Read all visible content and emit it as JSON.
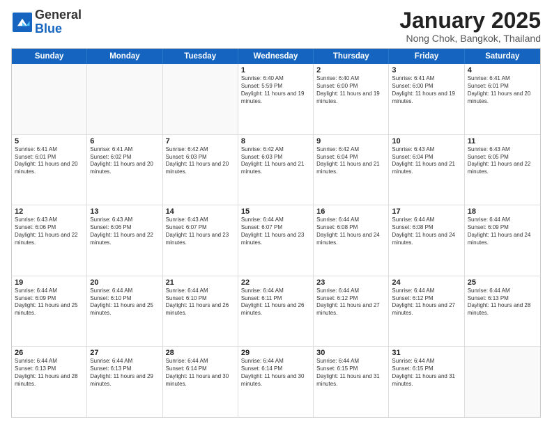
{
  "logo": {
    "general": "General",
    "blue": "Blue"
  },
  "header": {
    "month": "January 2025",
    "location": "Nong Chok, Bangkok, Thailand"
  },
  "weekdays": [
    "Sunday",
    "Monday",
    "Tuesday",
    "Wednesday",
    "Thursday",
    "Friday",
    "Saturday"
  ],
  "weeks": [
    [
      {
        "day": "",
        "info": ""
      },
      {
        "day": "",
        "info": ""
      },
      {
        "day": "",
        "info": ""
      },
      {
        "day": "1",
        "info": "Sunrise: 6:40 AM\nSunset: 5:59 PM\nDaylight: 11 hours and 19 minutes."
      },
      {
        "day": "2",
        "info": "Sunrise: 6:40 AM\nSunset: 6:00 PM\nDaylight: 11 hours and 19 minutes."
      },
      {
        "day": "3",
        "info": "Sunrise: 6:41 AM\nSunset: 6:00 PM\nDaylight: 11 hours and 19 minutes."
      },
      {
        "day": "4",
        "info": "Sunrise: 6:41 AM\nSunset: 6:01 PM\nDaylight: 11 hours and 20 minutes."
      }
    ],
    [
      {
        "day": "5",
        "info": "Sunrise: 6:41 AM\nSunset: 6:01 PM\nDaylight: 11 hours and 20 minutes."
      },
      {
        "day": "6",
        "info": "Sunrise: 6:41 AM\nSunset: 6:02 PM\nDaylight: 11 hours and 20 minutes."
      },
      {
        "day": "7",
        "info": "Sunrise: 6:42 AM\nSunset: 6:03 PM\nDaylight: 11 hours and 20 minutes."
      },
      {
        "day": "8",
        "info": "Sunrise: 6:42 AM\nSunset: 6:03 PM\nDaylight: 11 hours and 21 minutes."
      },
      {
        "day": "9",
        "info": "Sunrise: 6:42 AM\nSunset: 6:04 PM\nDaylight: 11 hours and 21 minutes."
      },
      {
        "day": "10",
        "info": "Sunrise: 6:43 AM\nSunset: 6:04 PM\nDaylight: 11 hours and 21 minutes."
      },
      {
        "day": "11",
        "info": "Sunrise: 6:43 AM\nSunset: 6:05 PM\nDaylight: 11 hours and 22 minutes."
      }
    ],
    [
      {
        "day": "12",
        "info": "Sunrise: 6:43 AM\nSunset: 6:06 PM\nDaylight: 11 hours and 22 minutes."
      },
      {
        "day": "13",
        "info": "Sunrise: 6:43 AM\nSunset: 6:06 PM\nDaylight: 11 hours and 22 minutes."
      },
      {
        "day": "14",
        "info": "Sunrise: 6:43 AM\nSunset: 6:07 PM\nDaylight: 11 hours and 23 minutes."
      },
      {
        "day": "15",
        "info": "Sunrise: 6:44 AM\nSunset: 6:07 PM\nDaylight: 11 hours and 23 minutes."
      },
      {
        "day": "16",
        "info": "Sunrise: 6:44 AM\nSunset: 6:08 PM\nDaylight: 11 hours and 24 minutes."
      },
      {
        "day": "17",
        "info": "Sunrise: 6:44 AM\nSunset: 6:08 PM\nDaylight: 11 hours and 24 minutes."
      },
      {
        "day": "18",
        "info": "Sunrise: 6:44 AM\nSunset: 6:09 PM\nDaylight: 11 hours and 24 minutes."
      }
    ],
    [
      {
        "day": "19",
        "info": "Sunrise: 6:44 AM\nSunset: 6:09 PM\nDaylight: 11 hours and 25 minutes."
      },
      {
        "day": "20",
        "info": "Sunrise: 6:44 AM\nSunset: 6:10 PM\nDaylight: 11 hours and 25 minutes."
      },
      {
        "day": "21",
        "info": "Sunrise: 6:44 AM\nSunset: 6:10 PM\nDaylight: 11 hours and 26 minutes."
      },
      {
        "day": "22",
        "info": "Sunrise: 6:44 AM\nSunset: 6:11 PM\nDaylight: 11 hours and 26 minutes."
      },
      {
        "day": "23",
        "info": "Sunrise: 6:44 AM\nSunset: 6:12 PM\nDaylight: 11 hours and 27 minutes."
      },
      {
        "day": "24",
        "info": "Sunrise: 6:44 AM\nSunset: 6:12 PM\nDaylight: 11 hours and 27 minutes."
      },
      {
        "day": "25",
        "info": "Sunrise: 6:44 AM\nSunset: 6:13 PM\nDaylight: 11 hours and 28 minutes."
      }
    ],
    [
      {
        "day": "26",
        "info": "Sunrise: 6:44 AM\nSunset: 6:13 PM\nDaylight: 11 hours and 28 minutes."
      },
      {
        "day": "27",
        "info": "Sunrise: 6:44 AM\nSunset: 6:13 PM\nDaylight: 11 hours and 29 minutes."
      },
      {
        "day": "28",
        "info": "Sunrise: 6:44 AM\nSunset: 6:14 PM\nDaylight: 11 hours and 30 minutes."
      },
      {
        "day": "29",
        "info": "Sunrise: 6:44 AM\nSunset: 6:14 PM\nDaylight: 11 hours and 30 minutes."
      },
      {
        "day": "30",
        "info": "Sunrise: 6:44 AM\nSunset: 6:15 PM\nDaylight: 11 hours and 31 minutes."
      },
      {
        "day": "31",
        "info": "Sunrise: 6:44 AM\nSunset: 6:15 PM\nDaylight: 11 hours and 31 minutes."
      },
      {
        "day": "",
        "info": ""
      }
    ]
  ]
}
